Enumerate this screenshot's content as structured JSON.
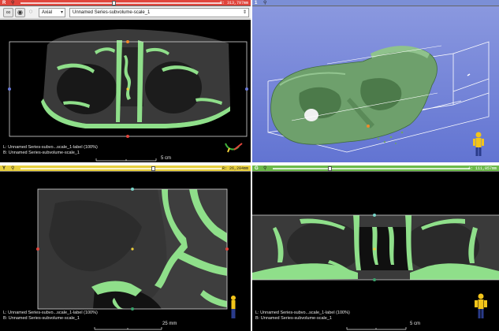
{
  "views": {
    "red": {
      "tag": "R",
      "offset": "R: 313,797mm",
      "orientation": "Axial",
      "volume": "Unnamed Series-subvolume-scale_1",
      "label_layer": "L: Unnamed Series-subvo...scale_1-label (100%)",
      "background_layer": "B: Unnamed Series-subvolume-scale_1",
      "ruler": "5 cm"
    },
    "three_d": {
      "tag": "1"
    },
    "yellow": {
      "tag": "Y",
      "offset": "R: 26,204mm",
      "label_layer": "L: Unnamed Series-subvo...scale_1-label (100%)",
      "background_layer": "B: Unnamed Series-subvolume-scale_1",
      "ruler": "25 mm"
    },
    "green": {
      "tag": "G",
      "offset": "A: 111,057mm",
      "label_layer": "L: Unnamed Series-subvo...scale_1-label (100%)",
      "background_layer": "B: Unnamed Series-subvolume-scale_1",
      "ruler": "5 cm"
    }
  },
  "colors": {
    "red_bar": "#e0453c",
    "yellow_bar": "#e7cf3f",
    "green_bar": "#6cba4a",
    "three_d_bar": "#7b8fd6",
    "segmentation": "#8fdf8a",
    "three_d_background": "#6d7fd8",
    "model_green": "#6ea06c"
  },
  "icons": {
    "pin": "pushpin-icon",
    "link": "link-icon",
    "eye": "eye-icon",
    "orientation_marker": "human-figure-icon",
    "axes": "axes-icon"
  }
}
